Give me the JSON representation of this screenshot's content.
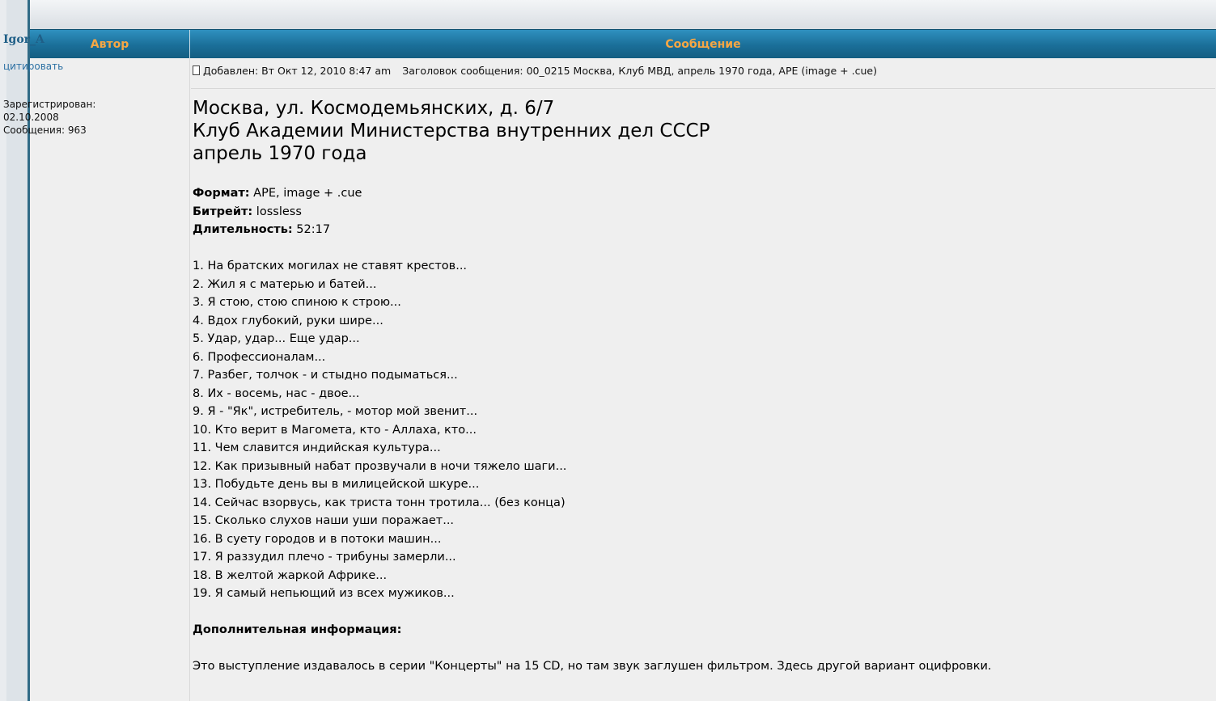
{
  "table": {
    "header_author": "Автор",
    "header_message": "Сообщение"
  },
  "author": {
    "username": "Igor_A",
    "quote_label": "цитировать",
    "registered_label": "Зарегистрирован:",
    "registered_date": "02.10.2008",
    "posts_label": "Сообщения: 963"
  },
  "post": {
    "added": "Добавлен: Вт Окт 12, 2010 8:47 am",
    "subject": "Заголовок сообщения: 00_0215 Москва, Клуб МВД, апрель 1970 года, APE (image + .cue)",
    "title_lines": [
      "Москва, ул. Космодемьянских, д. 6/7",
      "Клуб Академии Министерства внутренних дел СССР",
      "апрель 1970 года"
    ],
    "format_label": "Формат:",
    "format_value": " APE, image + .cue",
    "bitrate_label": "Битрейт:",
    "bitrate_value": " lossless",
    "duration_label": "Длительность:",
    "duration_value": " 52:17",
    "tracks": [
      "1. На братских могилах не ставят крестов...",
      "2. Жил я с матерью и батей...",
      "3. Я стою, стою спиною к строю...",
      "4. Вдох глубокий, руки шире...",
      "5. Удар, удар... Еще удар...",
      "6. Профессионалам...",
      "7. Разбег, толчок - и стыдно подыматься...",
      "8. Их - восемь, нас - двое...",
      "9. Я - \"Як\", истребитель, - мотор мой звенит...",
      "10. Кто верит в Магомета, кто - Аллаха, кто...",
      "11. Чем славится индийская культура...",
      "12. Как призывный набат прозвучали в ночи тяжело шаги...",
      "13. Побудьте день вы в милицейской шкуре...",
      "14. Сейчас взорвусь, как триста тонн тротила... (без конца)",
      "15. Сколько слухов наши уши поражает...",
      "16. В суету городов и в потоки машин...",
      "17. Я раззудил плечо - трибуны замерли...",
      "18. В желтой жаркой Африке...",
      "19. Я самый непьющий из всех мужиков..."
    ],
    "extra_title": "Дополнительная информация:",
    "extra_text": "Это выступление издавалось в серии \"Концерты\" на 15 CD, но там звук заглушен фильтром. Здесь другой вариант оцифровки."
  },
  "colors": {
    "header_bg": "#1a6e98",
    "header_text": "#f7a744",
    "username": "#1f5f87",
    "link": "#2c70a3",
    "cell_bg": "#efefef"
  }
}
